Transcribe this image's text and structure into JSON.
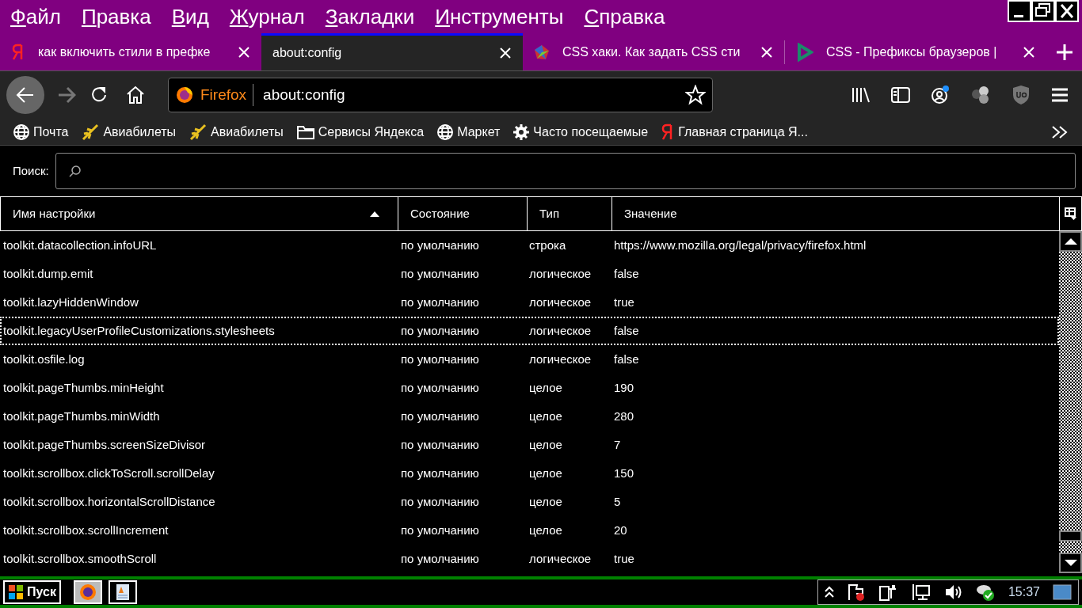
{
  "menu": [
    "Файл",
    "Правка",
    "Вид",
    "Журнал",
    "Закладки",
    "Инструменты",
    "Справка"
  ],
  "tabs": [
    {
      "kind": "yandex",
      "label": "как включить стили в префке",
      "selected": false
    },
    {
      "kind": "none",
      "label": "about:config",
      "selected": true
    },
    {
      "kind": "colorful",
      "label": "CSS хаки. Как задать CSS сти",
      "selected": false
    },
    {
      "kind": "play",
      "label": "CSS - Префиксы браузеров |",
      "selected": false
    }
  ],
  "toolbar": {
    "forward_disabled": true,
    "identity": "Firefox",
    "url": "about:config"
  },
  "bookmarks": [
    {
      "kind": "globe",
      "label": "Почта"
    },
    {
      "kind": "plane",
      "label": "Авиабилеты"
    },
    {
      "kind": "plane",
      "label": "Авиабилеты"
    },
    {
      "kind": "folder",
      "label": "Сервисы Яндекса"
    },
    {
      "kind": "globe",
      "label": "Маркет"
    },
    {
      "kind": "gear",
      "label": "Часто посещаемые"
    },
    {
      "kind": "yandex",
      "label": "Главная страница Я..."
    }
  ],
  "search": {
    "label": "Поиск:"
  },
  "table": {
    "columns": [
      "Имя настройки",
      "Состояние",
      "Тип",
      "Значение"
    ],
    "rows": [
      {
        "cells": [
          "toolkit.datacollection.infoURL",
          "по умолчанию",
          "строка",
          "https://www.mozilla.org/legal/privacy/firefox.html"
        ],
        "selected": false
      },
      {
        "cells": [
          "toolkit.dump.emit",
          "по умолчанию",
          "логическое",
          "false"
        ],
        "selected": false
      },
      {
        "cells": [
          "toolkit.lazyHiddenWindow",
          "по умолчанию",
          "логическое",
          "true"
        ],
        "selected": false
      },
      {
        "cells": [
          "toolkit.legacyUserProfileCustomizations.stylesheets",
          "по умолчанию",
          "логическое",
          "false"
        ],
        "selected": true
      },
      {
        "cells": [
          "toolkit.osfile.log",
          "по умолчанию",
          "логическое",
          "false"
        ],
        "selected": false
      },
      {
        "cells": [
          "toolkit.pageThumbs.minHeight",
          "по умолчанию",
          "целое",
          "190"
        ],
        "selected": false
      },
      {
        "cells": [
          "toolkit.pageThumbs.minWidth",
          "по умолчанию",
          "целое",
          "280"
        ],
        "selected": false
      },
      {
        "cells": [
          "toolkit.pageThumbs.screenSizeDivisor",
          "по умолчанию",
          "целое",
          "7"
        ],
        "selected": false
      },
      {
        "cells": [
          "toolkit.scrollbox.clickToScroll.scrollDelay",
          "по умолчанию",
          "целое",
          "150"
        ],
        "selected": false
      },
      {
        "cells": [
          "toolkit.scrollbox.horizontalScrollDistance",
          "по умолчанию",
          "целое",
          "5"
        ],
        "selected": false
      },
      {
        "cells": [
          "toolkit.scrollbox.scrollIncrement",
          "по умолчанию",
          "целое",
          "20"
        ],
        "selected": false
      },
      {
        "cells": [
          "toolkit.scrollbox.smoothScroll",
          "по умолчанию",
          "логическое",
          "true"
        ],
        "selected": false
      }
    ]
  },
  "taskbar": {
    "start": "Пуск",
    "clock": "15:37"
  }
}
